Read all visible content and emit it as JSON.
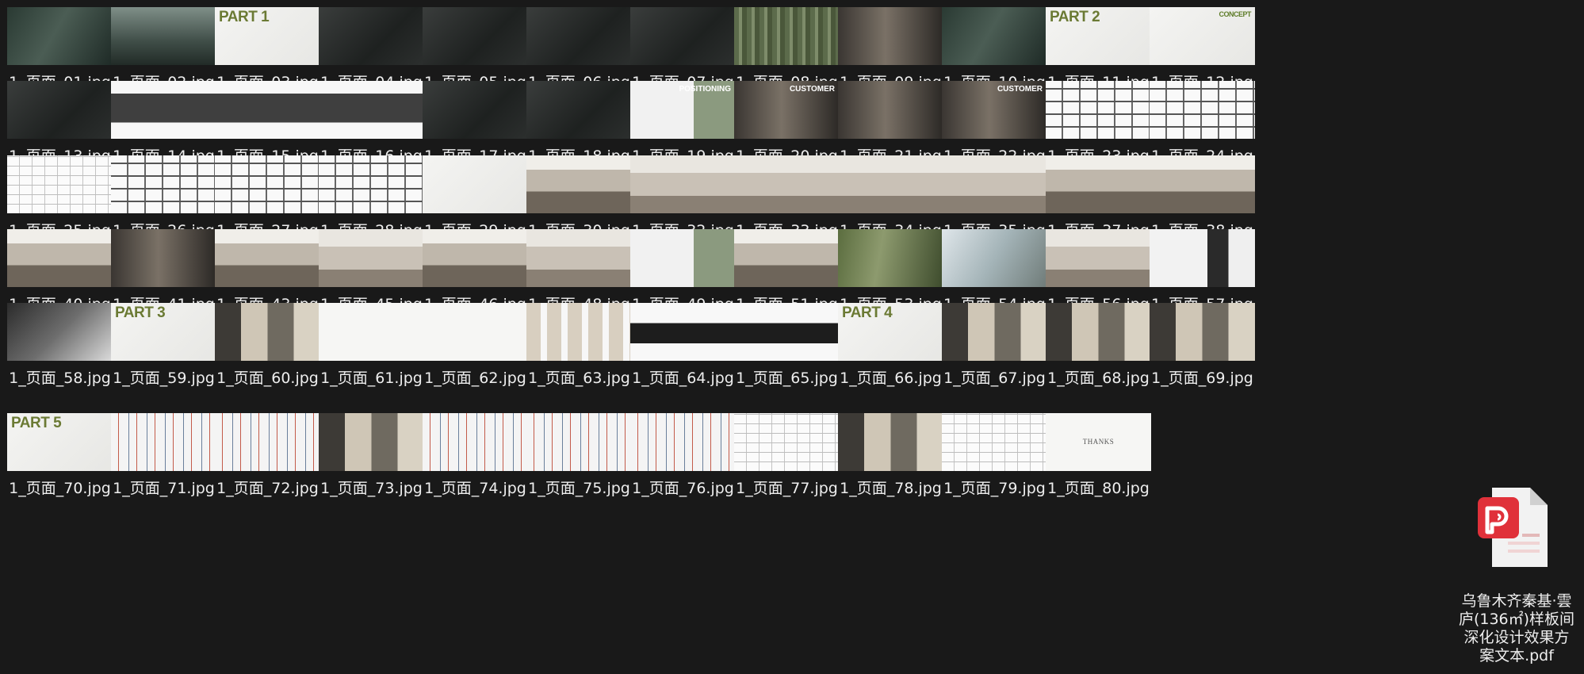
{
  "files": [
    {
      "name": "1_页面_01.jpg",
      "scheme": "s-forest"
    },
    {
      "name": "1_页面_02.jpg",
      "scheme": "s-mist"
    },
    {
      "name": "1_页面_03.jpg",
      "scheme": "s-paper",
      "thumb_text": "PART 1"
    },
    {
      "name": "1_页面_04.jpg",
      "scheme": "s-dark"
    },
    {
      "name": "1_页面_05.jpg",
      "scheme": "s-dark"
    },
    {
      "name": "1_页面_06.jpg",
      "scheme": "s-dark"
    },
    {
      "name": "1_页面_07.jpg",
      "scheme": "s-dark"
    },
    {
      "name": "1_页面_08.jpg",
      "scheme": "s-bamboo"
    },
    {
      "name": "1_页面_09.jpg",
      "scheme": "s-roomdark"
    },
    {
      "name": "1_页面_10.jpg",
      "scheme": "s-forest"
    },
    {
      "name": "1_页面_11.jpg",
      "scheme": "s-paper",
      "thumb_text": "PART 2"
    },
    {
      "name": "1_页面_12.jpg",
      "scheme": "s-paper",
      "thumb_text": "CONCEPT"
    },
    {
      "name": "1_页面_13.jpg",
      "scheme": "s-dark"
    },
    {
      "name": "1_页面_14.jpg",
      "scheme": "s-greybar"
    },
    {
      "name": "1_页面_15.jpg",
      "scheme": "s-greybar"
    },
    {
      "name": "1_页面_16.jpg",
      "scheme": "s-greybar"
    },
    {
      "name": "1_页面_17.jpg",
      "scheme": "s-dark"
    },
    {
      "name": "1_页面_18.jpg",
      "scheme": "s-dark"
    },
    {
      "name": "1_页面_19.jpg",
      "scheme": "s-window",
      "thumb_text": "POSITIONING"
    },
    {
      "name": "1_页面_20.jpg",
      "scheme": "s-roomdark",
      "thumb_text": "CUSTOMER"
    },
    {
      "name": "1_页面_21.jpg",
      "scheme": "s-roomdark"
    },
    {
      "name": "1_页面_22.jpg",
      "scheme": "s-roomdark",
      "thumb_text": "CUSTOMER"
    },
    {
      "name": "1_页面_23.jpg",
      "scheme": "s-planblk"
    },
    {
      "name": "1_页面_24.jpg",
      "scheme": "s-planblk"
    },
    {
      "name": "1_页面_25.jpg",
      "scheme": "s-plan"
    },
    {
      "name": "1_页面_26.jpg",
      "scheme": "s-planblk"
    },
    {
      "name": "1_页面_27.jpg",
      "scheme": "s-planblk"
    },
    {
      "name": "1_页面_28.jpg",
      "scheme": "s-planblk"
    },
    {
      "name": "1_页面_29.jpg",
      "scheme": "s-paper"
    },
    {
      "name": "1_页面_30.jpg",
      "scheme": "s-room2"
    },
    {
      "name": "1_页面_32.jpg",
      "scheme": "s-room"
    },
    {
      "name": "1_页面_33.jpg",
      "scheme": "s-room"
    },
    {
      "name": "1_页面_34.jpg",
      "scheme": "s-room"
    },
    {
      "name": "1_页面_35.jpg",
      "scheme": "s-room"
    },
    {
      "name": "1_页面_37.jpg",
      "scheme": "s-room2"
    },
    {
      "name": "1_页面_38.jpg",
      "scheme": "s-room2"
    },
    {
      "name": "1_页面_40.jpg",
      "scheme": "s-room2"
    },
    {
      "name": "1_页面_41.jpg",
      "scheme": "s-roomdark"
    },
    {
      "name": "1_页面_43.jpg",
      "scheme": "s-room2"
    },
    {
      "name": "1_页面_45.jpg",
      "scheme": "s-room"
    },
    {
      "name": "1_页面_46.jpg",
      "scheme": "s-room2"
    },
    {
      "name": "1_页面_48.jpg",
      "scheme": "s-room"
    },
    {
      "name": "1_页面_49.jpg",
      "scheme": "s-window"
    },
    {
      "name": "1_页面_51.jpg",
      "scheme": "s-room2"
    },
    {
      "name": "1_页面_53.jpg",
      "scheme": "s-green"
    },
    {
      "name": "1_页面_54.jpg",
      "scheme": "s-bright"
    },
    {
      "name": "1_页面_56.jpg",
      "scheme": "s-room"
    },
    {
      "name": "1_页面_57.jpg",
      "scheme": "s-panel"
    },
    {
      "name": "1_页面_58.jpg",
      "scheme": "s-sofa"
    },
    {
      "name": "1_页面_59.jpg",
      "scheme": "s-paper",
      "thumb_text": "PART 3"
    },
    {
      "name": "1_页面_60.jpg",
      "scheme": "s-collage"
    },
    {
      "name": "1_页面_61.jpg",
      "scheme": "s-white"
    },
    {
      "name": "1_页面_62.jpg",
      "scheme": "s-white"
    },
    {
      "name": "1_页面_63.jpg",
      "scheme": "s-swatch"
    },
    {
      "name": "1_页面_64.jpg",
      "scheme": "s-product"
    },
    {
      "name": "1_页面_65.jpg",
      "scheme": "s-product"
    },
    {
      "name": "1_页面_66.jpg",
      "scheme": "s-paper",
      "thumb_text": "PART 4"
    },
    {
      "name": "1_页面_67.jpg",
      "scheme": "s-collage"
    },
    {
      "name": "1_页面_68.jpg",
      "scheme": "s-collage"
    },
    {
      "name": "1_页面_69.jpg",
      "scheme": "s-collage"
    },
    {
      "name": "1_页面_70.jpg",
      "scheme": "s-paper",
      "thumb_text": "PART 5"
    },
    {
      "name": "1_页面_71.jpg",
      "scheme": "s-elev"
    },
    {
      "name": "1_页面_72.jpg",
      "scheme": "s-elev"
    },
    {
      "name": "1_页面_73.jpg",
      "scheme": "s-collage"
    },
    {
      "name": "1_页面_74.jpg",
      "scheme": "s-elev"
    },
    {
      "name": "1_页面_75.jpg",
      "scheme": "s-elev"
    },
    {
      "name": "1_页面_76.jpg",
      "scheme": "s-elev"
    },
    {
      "name": "1_页面_77.jpg",
      "scheme": "s-plan"
    },
    {
      "name": "1_页面_78.jpg",
      "scheme": "s-collage"
    },
    {
      "name": "1_页面_79.jpg",
      "scheme": "s-plan"
    },
    {
      "name": "1_页面_80.jpg",
      "scheme": "s-white",
      "thumb_text": "THANKS"
    }
  ],
  "pdf": {
    "name": "乌鲁木齐秦基·雲庐(136㎡)样板间深化设计效果方案文本.pdf",
    "icon": "pdf-file-icon",
    "accent": "#e0313a"
  },
  "colors": {
    "background": "#191919",
    "label_text": "#eeeeee",
    "part_title_green": "#6b7a34"
  }
}
